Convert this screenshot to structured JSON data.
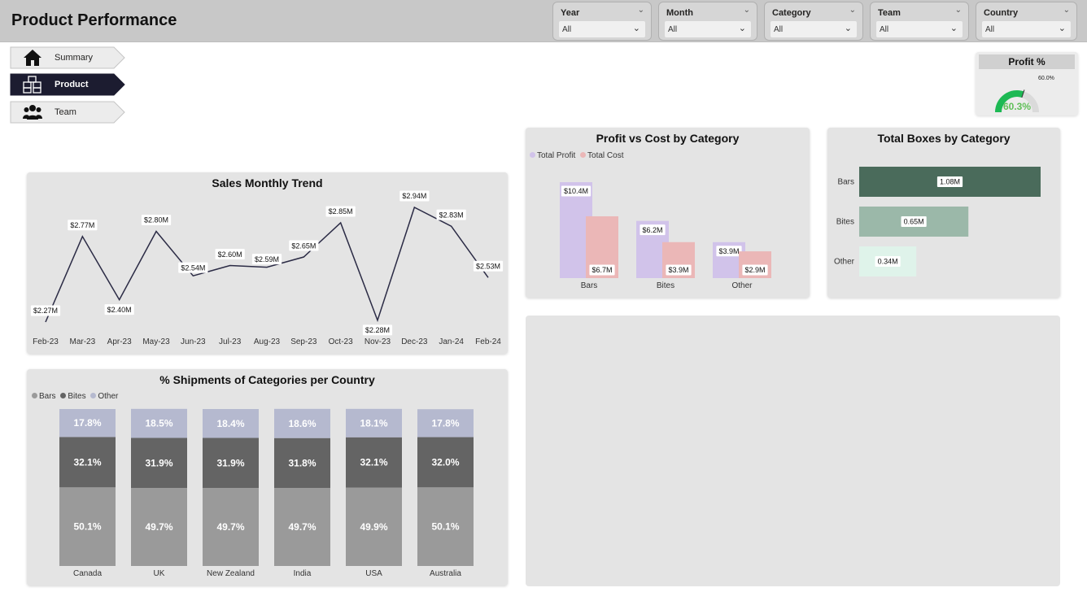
{
  "header": {
    "title": "Product Performance"
  },
  "filters": [
    {
      "label": "Year",
      "value": "All"
    },
    {
      "label": "Month",
      "value": "All"
    },
    {
      "label": "Category",
      "value": "All"
    },
    {
      "label": "Team",
      "value": "All"
    },
    {
      "label": "Country",
      "value": "All"
    }
  ],
  "nav": [
    {
      "label": "Summary",
      "icon": "home-icon",
      "active": false
    },
    {
      "label": "Product",
      "icon": "boxes-icon",
      "active": true
    },
    {
      "label": "Team",
      "icon": "team-icon",
      "active": false
    }
  ],
  "gauge": {
    "title": "Profit %",
    "value_label": "60.3%",
    "target_label": "60.0%",
    "value": 60.3,
    "target": 60.0,
    "min": 0,
    "max": 100,
    "color": "#1db954"
  },
  "chart_data": [
    {
      "type": "line",
      "title": "Sales Monthly Trend",
      "categories": [
        "Feb-23",
        "Mar-23",
        "Apr-23",
        "May-23",
        "Jun-23",
        "Jul-23",
        "Aug-23",
        "Sep-23",
        "Oct-23",
        "Nov-23",
        "Dec-23",
        "Jan-24",
        "Feb-24"
      ],
      "values": [
        2.27,
        2.77,
        2.4,
        2.8,
        2.54,
        2.6,
        2.59,
        2.65,
        2.85,
        2.28,
        2.94,
        2.83,
        2.53
      ],
      "labels": [
        "$2.27M",
        "$2.77M",
        "$2.40M",
        "$2.80M",
        "$2.54M",
        "$2.60M",
        "$2.59M",
        "$2.65M",
        "$2.85M",
        "$2.28M",
        "$2.94M",
        "$2.83M",
        "$2.53M"
      ],
      "unit": "$M",
      "line_color": "#2b2b45"
    },
    {
      "type": "bar",
      "title": "Profit vs Cost by Category",
      "categories": [
        "Bars",
        "Bites",
        "Other"
      ],
      "series": [
        {
          "name": "Total Profit",
          "values": [
            10.4,
            6.2,
            3.9
          ],
          "labels": [
            "$10.4M",
            "$6.2M",
            "$3.9M"
          ],
          "color": "#d1c3ea"
        },
        {
          "name": "Total Cost",
          "values": [
            6.7,
            3.9,
            2.9
          ],
          "labels": [
            "$6.7M",
            "$3.9M",
            "$2.9M"
          ],
          "color": "#ebb7b7"
        }
      ],
      "unit": "$M"
    },
    {
      "type": "bar",
      "orientation": "horizontal",
      "title": "Total Boxes by Category",
      "categories": [
        "Bars",
        "Bites",
        "Other"
      ],
      "values": [
        1.08,
        0.65,
        0.34
      ],
      "labels": [
        "1.08M",
        "0.65M",
        "0.34M"
      ],
      "colors": [
        "#4a6b5b",
        "#9bb8a9",
        "#dff3ea"
      ],
      "unit": "M"
    },
    {
      "type": "bar",
      "stacked": true,
      "percent": true,
      "title": "% Shipments of Categories per Country",
      "categories": [
        "Canada",
        "UK",
        "New Zealand",
        "India",
        "USA",
        "Australia"
      ],
      "series": [
        {
          "name": "Bars",
          "values": [
            50.1,
            49.7,
            49.7,
            49.7,
            49.9,
            50.1
          ],
          "color": "#9a9a9a"
        },
        {
          "name": "Bites",
          "values": [
            32.1,
            31.9,
            31.9,
            31.8,
            32.1,
            32.0
          ],
          "color": "#646464"
        },
        {
          "name": "Other",
          "values": [
            17.8,
            18.5,
            18.4,
            18.6,
            18.1,
            17.8
          ],
          "color": "#b5b9cf"
        }
      ]
    }
  ]
}
